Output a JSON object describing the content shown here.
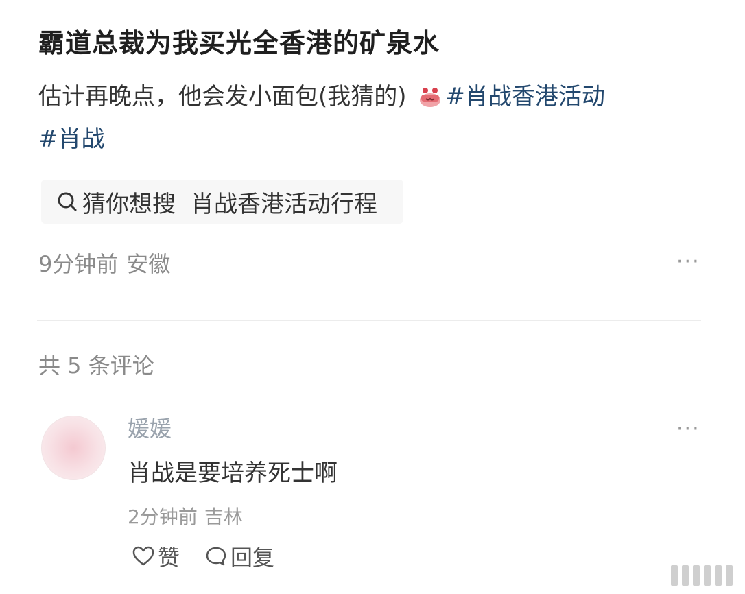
{
  "post": {
    "title": "霸道总裁为我买光全香港的矿泉水",
    "body_text": "估计再晚点，他会发小面包(我猜的) ",
    "emoji_icon": "cake-emoji-icon",
    "topics": [
      "#肖战香港活动",
      "#肖战"
    ],
    "guess_search": {
      "label": "猜你想搜",
      "query": "肖战香港活动行程"
    },
    "time": "9分钟前",
    "location": "安徽",
    "more": "···"
  },
  "comments": {
    "count_label": "共 5 条评论",
    "items": [
      {
        "username": "媛媛",
        "text": "肖战是要培养死士啊",
        "time": "2分钟前",
        "location": "吉林",
        "more": "···",
        "like_label": "赞",
        "reply_label": "回复"
      }
    ]
  },
  "colors": {
    "topic": "#23486e",
    "muted": "#8a8a8a"
  }
}
